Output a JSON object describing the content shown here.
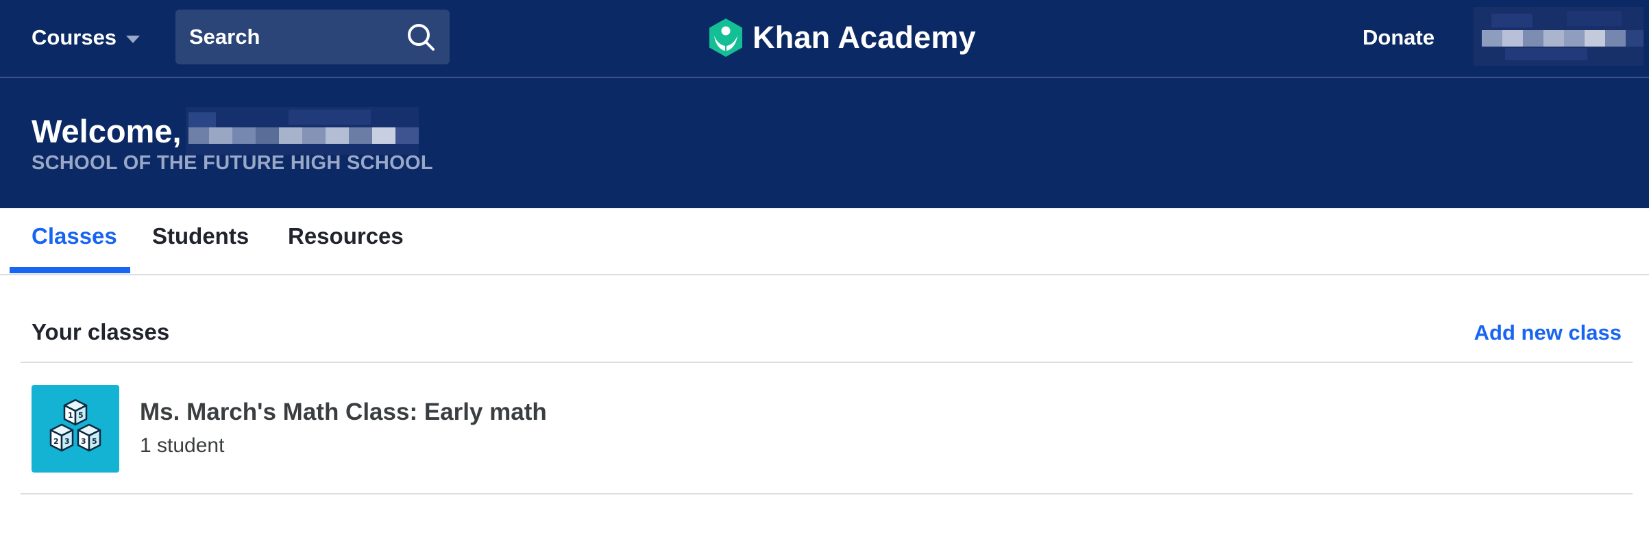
{
  "nav": {
    "courses_label": "Courses",
    "search_label": "Search",
    "brand_name": "Khan Academy",
    "donate_label": "Donate"
  },
  "banner": {
    "welcome_text": "Welcome,",
    "school_name": "SCHOOL OF THE FUTURE HIGH SCHOOL"
  },
  "tabs": [
    {
      "label": "Classes",
      "active": true
    },
    {
      "label": "Students",
      "active": false
    },
    {
      "label": "Resources",
      "active": false
    }
  ],
  "classes_section": {
    "title": "Your classes",
    "add_label": "Add new class",
    "items": [
      {
        "name": "Ms. March's Math Class: Early math",
        "student_count": "1 student",
        "icon": "math-blocks-icon"
      }
    ]
  },
  "colors": {
    "nav_bg": "#0b2965",
    "search_bg": "#2c4579",
    "accent_blue": "#1865f2",
    "brand_green": "#14bf96",
    "class_icon_bg": "#14b3d4",
    "muted_text": "#9aa8c7"
  }
}
